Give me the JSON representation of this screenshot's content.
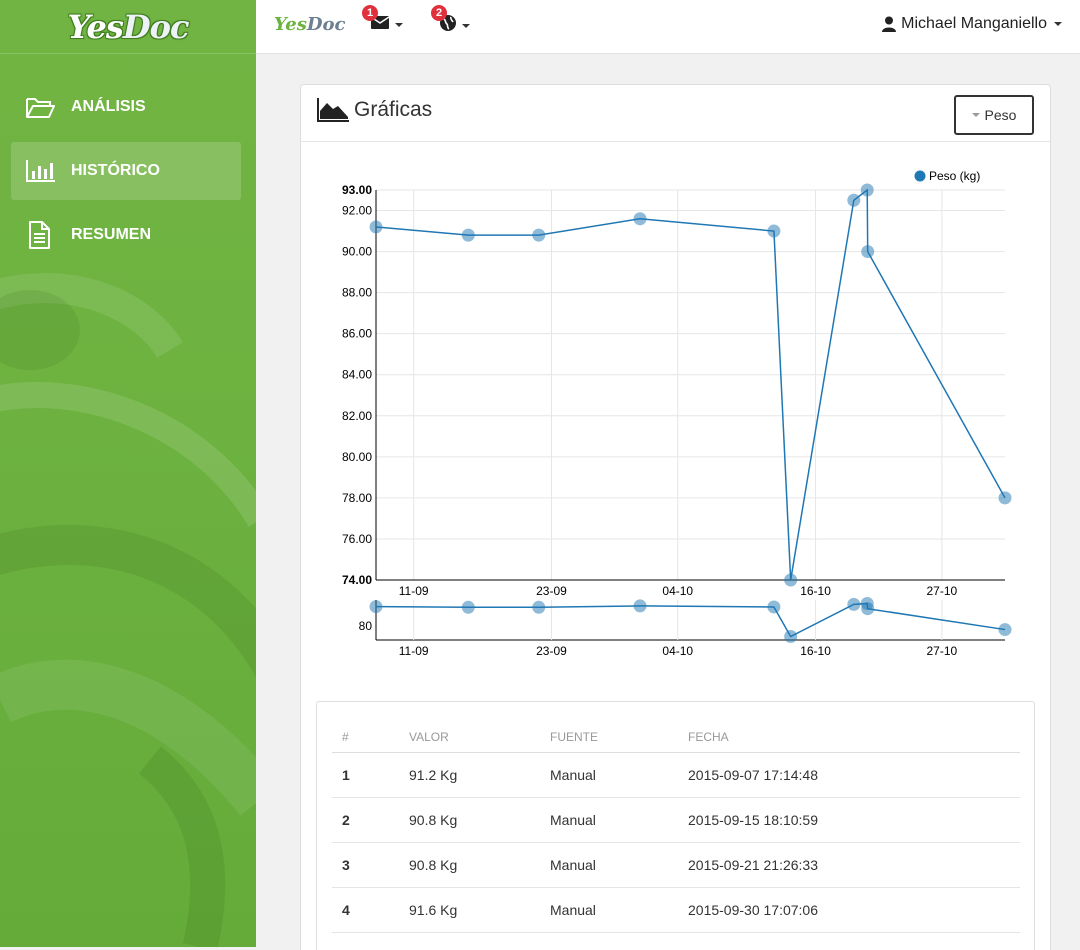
{
  "brand": {
    "logo_yes": "Yes",
    "logo_doc": "Doc"
  },
  "sidebar": {
    "items": [
      {
        "label": "ANÁLISIS",
        "icon": "folder-open-icon"
      },
      {
        "label": "HISTÓRICO",
        "icon": "bar-chart-icon",
        "active": true
      },
      {
        "label": "RESUMEN",
        "icon": "document-icon"
      }
    ]
  },
  "topbar": {
    "brand_yes": "Yes",
    "brand_doc": "Doc",
    "messages_badge": "1",
    "messages_icon": "envelope-icon",
    "notifications_badge": "2",
    "notifications_icon": "globe-icon",
    "user_name": "Michael Manganiello",
    "user_icon": "user-icon"
  },
  "panel": {
    "title": "Gráficas",
    "title_icon": "area-chart-icon",
    "dropdown_label": "Peso"
  },
  "colors": {
    "accent_green": "#6bb33f",
    "series_blue": "#1f77b4",
    "badge_red": "#e0303b"
  },
  "chart_data": [
    {
      "type": "line",
      "legend": "Peso (kg)",
      "legend_position": "top-right",
      "x": [
        "2015-09-07 17:14",
        "2015-09-15 18:10",
        "2015-09-21 21:26",
        "2015-09-30 17:07",
        "2015-10-12 09:00",
        "2015-10-13 20:00",
        "2015-10-19 08:00",
        "2015-10-20 12:00",
        "2015-10-20 13:00",
        "2015-11-01 12:00"
      ],
      "values": [
        91.2,
        90.8,
        90.8,
        91.6,
        91.0,
        74.0,
        92.5,
        93.0,
        90.0,
        78.0
      ],
      "ylim": [
        74,
        93
      ],
      "yticks": [
        "93.00",
        "92.00",
        "90.00",
        "88.00",
        "86.00",
        "84.00",
        "82.00",
        "80.00",
        "78.00",
        "76.00",
        "74.00"
      ],
      "xticks": [
        "11-09",
        "23-09",
        "04-10",
        "16-10",
        "27-10"
      ],
      "grid": true
    },
    {
      "type": "line",
      "role": "overview",
      "yticks": [
        "80"
      ],
      "xticks": [
        "11-09",
        "23-09",
        "04-10",
        "16-10",
        "27-10"
      ]
    }
  ],
  "table": {
    "headers": [
      "#",
      "VALOR",
      "FUENTE",
      "FECHA"
    ],
    "rows": [
      {
        "num": "1",
        "valor": "91.2 Kg",
        "fuente": "Manual",
        "fecha": "2015-09-07 17:14:48"
      },
      {
        "num": "2",
        "valor": "90.8 Kg",
        "fuente": "Manual",
        "fecha": "2015-09-15 18:10:59"
      },
      {
        "num": "3",
        "valor": "90.8 Kg",
        "fuente": "Manual",
        "fecha": "2015-09-21 21:26:33"
      },
      {
        "num": "4",
        "valor": "91.6 Kg",
        "fuente": "Manual",
        "fecha": "2015-09-30 17:07:06"
      }
    ]
  }
}
